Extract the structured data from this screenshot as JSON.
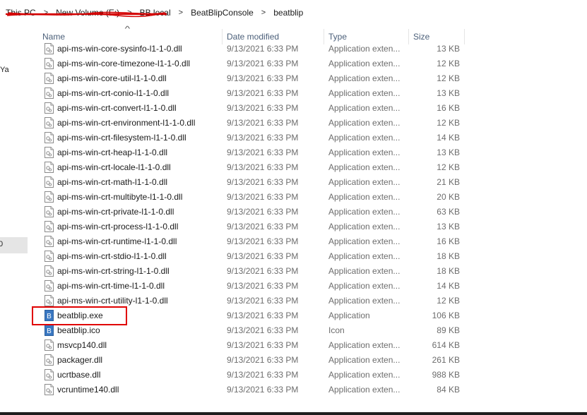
{
  "breadcrumb": {
    "items": [
      "This PC",
      "New Volume (E:)",
      "BB.local",
      "BeatBlipConsole",
      "beatblip"
    ],
    "separator": ">"
  },
  "nav": {
    "partial_text": "Ya",
    "selected_partial_text": "0",
    "selected_bg": "#e5e5e5"
  },
  "columns": {
    "name": "Name",
    "date": "Date modified",
    "type": "Type",
    "size": "Size"
  },
  "files": [
    {
      "name": "api-ms-win-core-sysinfo-l1-1-0.dll",
      "date": "9/13/2021 6:33 PM",
      "type": "Application exten...",
      "size": "13 KB",
      "icon": "dll-file-icon"
    },
    {
      "name": "api-ms-win-core-timezone-l1-1-0.dll",
      "date": "9/13/2021 6:33 PM",
      "type": "Application exten...",
      "size": "12 KB",
      "icon": "dll-file-icon"
    },
    {
      "name": "api-ms-win-core-util-l1-1-0.dll",
      "date": "9/13/2021 6:33 PM",
      "type": "Application exten...",
      "size": "12 KB",
      "icon": "dll-file-icon"
    },
    {
      "name": "api-ms-win-crt-conio-l1-1-0.dll",
      "date": "9/13/2021 6:33 PM",
      "type": "Application exten...",
      "size": "13 KB",
      "icon": "dll-file-icon"
    },
    {
      "name": "api-ms-win-crt-convert-l1-1-0.dll",
      "date": "9/13/2021 6:33 PM",
      "type": "Application exten...",
      "size": "16 KB",
      "icon": "dll-file-icon"
    },
    {
      "name": "api-ms-win-crt-environment-l1-1-0.dll",
      "date": "9/13/2021 6:33 PM",
      "type": "Application exten...",
      "size": "12 KB",
      "icon": "dll-file-icon"
    },
    {
      "name": "api-ms-win-crt-filesystem-l1-1-0.dll",
      "date": "9/13/2021 6:33 PM",
      "type": "Application exten...",
      "size": "14 KB",
      "icon": "dll-file-icon"
    },
    {
      "name": "api-ms-win-crt-heap-l1-1-0.dll",
      "date": "9/13/2021 6:33 PM",
      "type": "Application exten...",
      "size": "13 KB",
      "icon": "dll-file-icon"
    },
    {
      "name": "api-ms-win-crt-locale-l1-1-0.dll",
      "date": "9/13/2021 6:33 PM",
      "type": "Application exten...",
      "size": "12 KB",
      "icon": "dll-file-icon"
    },
    {
      "name": "api-ms-win-crt-math-l1-1-0.dll",
      "date": "9/13/2021 6:33 PM",
      "type": "Application exten...",
      "size": "21 KB",
      "icon": "dll-file-icon"
    },
    {
      "name": "api-ms-win-crt-multibyte-l1-1-0.dll",
      "date": "9/13/2021 6:33 PM",
      "type": "Application exten...",
      "size": "20 KB",
      "icon": "dll-file-icon"
    },
    {
      "name": "api-ms-win-crt-private-l1-1-0.dll",
      "date": "9/13/2021 6:33 PM",
      "type": "Application exten...",
      "size": "63 KB",
      "icon": "dll-file-icon"
    },
    {
      "name": "api-ms-win-crt-process-l1-1-0.dll",
      "date": "9/13/2021 6:33 PM",
      "type": "Application exten...",
      "size": "13 KB",
      "icon": "dll-file-icon"
    },
    {
      "name": "api-ms-win-crt-runtime-l1-1-0.dll",
      "date": "9/13/2021 6:33 PM",
      "type": "Application exten...",
      "size": "16 KB",
      "icon": "dll-file-icon"
    },
    {
      "name": "api-ms-win-crt-stdio-l1-1-0.dll",
      "date": "9/13/2021 6:33 PM",
      "type": "Application exten...",
      "size": "18 KB",
      "icon": "dll-file-icon"
    },
    {
      "name": "api-ms-win-crt-string-l1-1-0.dll",
      "date": "9/13/2021 6:33 PM",
      "type": "Application exten...",
      "size": "18 KB",
      "icon": "dll-file-icon"
    },
    {
      "name": "api-ms-win-crt-time-l1-1-0.dll",
      "date": "9/13/2021 6:33 PM",
      "type": "Application exten...",
      "size": "14 KB",
      "icon": "dll-file-icon"
    },
    {
      "name": "api-ms-win-crt-utility-l1-1-0.dll",
      "date": "9/13/2021 6:33 PM",
      "type": "Application exten...",
      "size": "12 KB",
      "icon": "dll-file-icon"
    },
    {
      "name": "beatblip.exe",
      "date": "9/13/2021 6:33 PM",
      "type": "Application",
      "size": "106 KB",
      "icon": "app-b-icon",
      "highlighted": true
    },
    {
      "name": "beatblip.ico",
      "date": "9/13/2021 6:33 PM",
      "type": "Icon",
      "size": "89 KB",
      "icon": "app-b-icon"
    },
    {
      "name": "msvcp140.dll",
      "date": "9/13/2021 6:33 PM",
      "type": "Application exten...",
      "size": "614 KB",
      "icon": "dll-file-icon"
    },
    {
      "name": "packager.dll",
      "date": "9/13/2021 6:33 PM",
      "type": "Application exten...",
      "size": "261 KB",
      "icon": "dll-file-icon"
    },
    {
      "name": "ucrtbase.dll",
      "date": "9/13/2021 6:33 PM",
      "type": "Application exten...",
      "size": "988 KB",
      "icon": "dll-file-icon"
    },
    {
      "name": "vcruntime140.dll",
      "date": "9/13/2021 6:33 PM",
      "type": "Application exten...",
      "size": "84 KB",
      "icon": "dll-file-icon"
    }
  ],
  "colors": {
    "header_text": "#4c607a",
    "meta_text": "#6d6d6d",
    "highlight_box": "#e00000",
    "redaction_scribble": "#d40000",
    "exe_icon": "#3a78c2"
  }
}
